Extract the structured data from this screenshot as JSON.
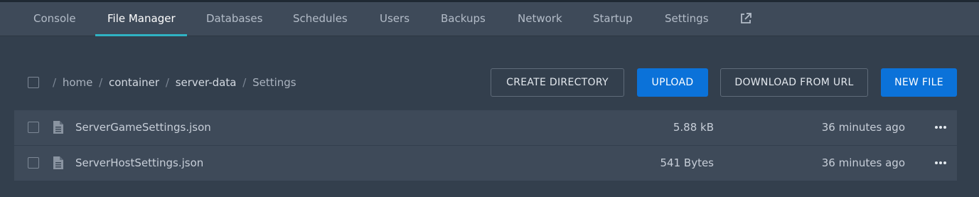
{
  "nav": {
    "tabs": [
      {
        "label": "Console",
        "active": false
      },
      {
        "label": "File Manager",
        "active": true
      },
      {
        "label": "Databases",
        "active": false
      },
      {
        "label": "Schedules",
        "active": false
      },
      {
        "label": "Users",
        "active": false
      },
      {
        "label": "Backups",
        "active": false
      },
      {
        "label": "Network",
        "active": false
      },
      {
        "label": "Startup",
        "active": false
      },
      {
        "label": "Settings",
        "active": false
      }
    ],
    "external_icon": "external-link-icon",
    "accent_color": "#2fb3c4"
  },
  "breadcrumb": {
    "separator": "/",
    "segments": [
      "home",
      "container",
      "server-data"
    ],
    "current": "Settings"
  },
  "actions": {
    "create_directory": "CREATE DIRECTORY",
    "upload": "UPLOAD",
    "download_from_url": "DOWNLOAD FROM URL",
    "new_file": "NEW FILE",
    "primary_color": "#0b72d9"
  },
  "files": [
    {
      "name": "ServerGameSettings.json",
      "size": "5.88 kB",
      "modified": "36 minutes ago",
      "icon": "file-text-icon"
    },
    {
      "name": "ServerHostSettings.json",
      "size": "541 Bytes",
      "modified": "36 minutes ago",
      "icon": "file-text-icon"
    }
  ]
}
